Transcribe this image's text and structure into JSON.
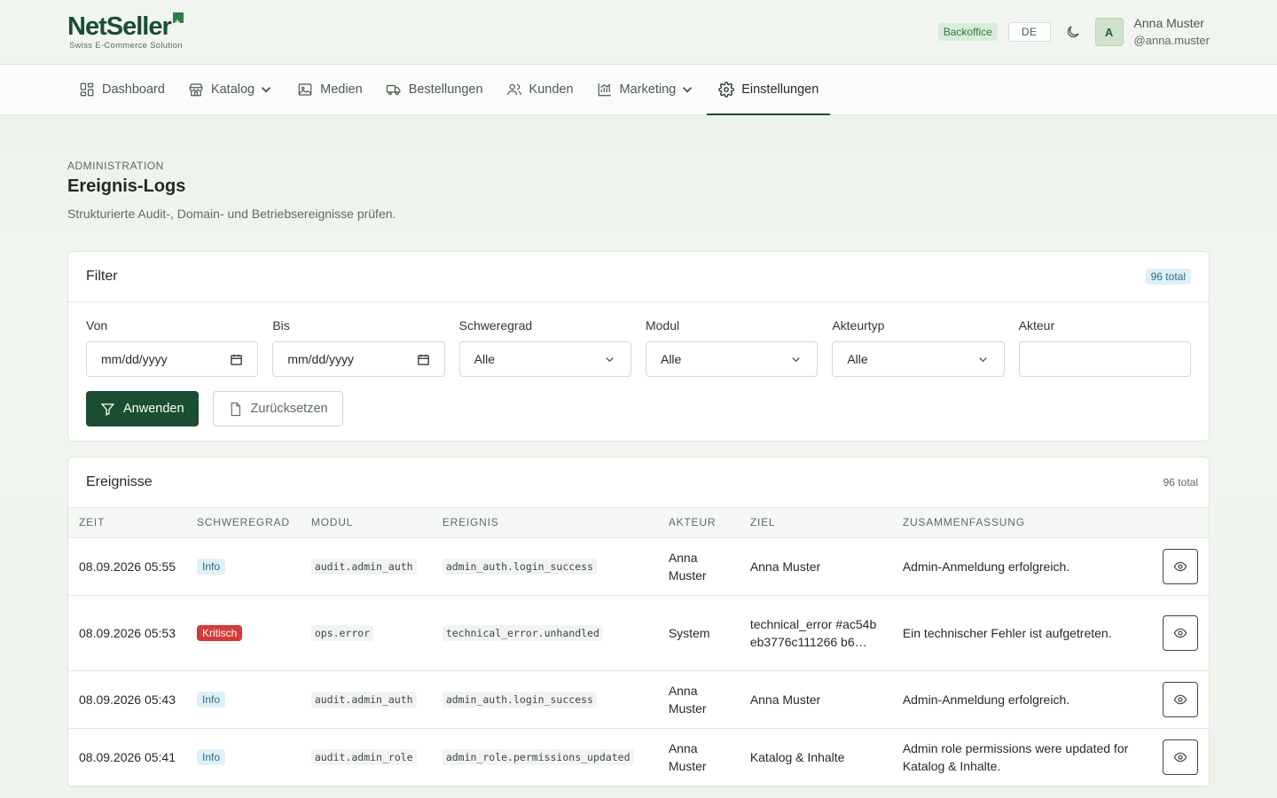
{
  "brand": {
    "name_part1": "Net",
    "name_part2": "Seller",
    "tagline": "Swiss E-Commerce Solution"
  },
  "header": {
    "env_badge": "Backoffice",
    "language": "DE",
    "avatar_initial": "A",
    "user_name": "Anna Muster",
    "user_handle": "@anna.muster"
  },
  "nav": {
    "items": [
      {
        "label": "Dashboard",
        "icon": "dashboard-icon"
      },
      {
        "label": "Katalog",
        "icon": "store-icon"
      },
      {
        "label": "Medien",
        "icon": "image-icon"
      },
      {
        "label": "Bestellungen",
        "icon": "truck-icon"
      },
      {
        "label": "Kunden",
        "icon": "users-icon"
      },
      {
        "label": "Marketing",
        "icon": "chart-icon"
      },
      {
        "label": "Einstellungen",
        "icon": "gear-icon"
      }
    ]
  },
  "page": {
    "eyebrow": "ADMINISTRATION",
    "title": "Ereignis-Logs",
    "subtitle": "Strukturierte Audit-, Domain- und Betriebsereignisse prüfen."
  },
  "filter": {
    "title": "Filter",
    "total_badge": "96 total",
    "fields": {
      "from_label": "Von",
      "from_value": "mm/dd/yyyy",
      "to_label": "Bis",
      "to_value": "mm/dd/yyyy",
      "severity_label": "Schweregrad",
      "severity_value": "Alle",
      "module_label": "Modul",
      "module_value": "Alle",
      "actor_type_label": "Akteurtyp",
      "actor_type_value": "Alle",
      "actor_label": "Akteur",
      "actor_value": ""
    },
    "apply_label": "Anwenden",
    "reset_label": "Zurücksetzen"
  },
  "events": {
    "title": "Ereignisse",
    "total": "96 total",
    "columns": {
      "time": "ZEIT",
      "severity": "SCHWEREGRAD",
      "module": "MODUL",
      "event": "EREIGNIS",
      "actor": "AKTEUR",
      "target": "ZIEL",
      "summary": "ZUSAMMENFASSUNG"
    },
    "rows": [
      {
        "time": "08.09.2026 05:55",
        "severity": "Info",
        "module": "audit.admin_auth",
        "event": "admin_auth.login_success",
        "actor": "Anna Muster",
        "target": "Anna Muster",
        "summary": "Admin-Anmeldung erfolgreich."
      },
      {
        "time": "08.09.2026 05:53",
        "severity": "Kritisch",
        "module": "ops.error",
        "event": "technical_error.unhandled",
        "actor": "System",
        "target": "technical_error #ac54beb3776c111266 b6…",
        "summary": "Ein technischer Fehler ist aufgetreten."
      },
      {
        "time": "08.09.2026 05:43",
        "severity": "Info",
        "module": "audit.admin_auth",
        "event": "admin_auth.login_success",
        "actor": "Anna Muster",
        "target": "Anna Muster",
        "summary": "Admin-Anmeldung erfolgreich."
      },
      {
        "time": "08.09.2026 05:41",
        "severity": "Info",
        "module": "audit.admin_role",
        "event": "admin_role.permissions_updated",
        "actor": "Anna Muster",
        "target": "Katalog & Inhalte",
        "summary": "Admin role permissions were updated for Katalog & Inhalte."
      }
    ]
  },
  "colors": {
    "brand": "#1b4d33",
    "info_bg": "#e0f0f8",
    "critical_bg": "#d43a3a"
  }
}
